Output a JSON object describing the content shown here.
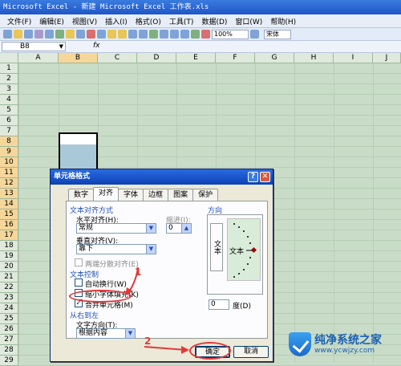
{
  "window": {
    "title": "Microsoft Excel - 新建 Microsoft Excel 工作表.xls"
  },
  "menu": [
    "文件(F)",
    "编辑(E)",
    "视图(V)",
    "插入(I)",
    "格式(O)",
    "工具(T)",
    "数据(D)",
    "窗口(W)",
    "帮助(H)"
  ],
  "toolbar": {
    "zoom": "100%",
    "font": "宋体"
  },
  "formula_bar": {
    "name_box": "B8",
    "fx": "fx"
  },
  "sheet": {
    "columns": [
      "A",
      "B",
      "C",
      "D",
      "E",
      "F",
      "G",
      "H",
      "I",
      "J"
    ],
    "selected_column": "B",
    "rows": [
      "1",
      "2",
      "3",
      "4",
      "5",
      "6",
      "7",
      "8",
      "9",
      "10",
      "11",
      "12",
      "13",
      "14",
      "15",
      "16",
      "17",
      "18",
      "19",
      "20",
      "21",
      "22",
      "23",
      "24",
      "25",
      "26",
      "27",
      "28",
      "29"
    ],
    "selected_rows_from": 8,
    "selected_rows_to": 17
  },
  "dialog": {
    "title": "单元格格式",
    "help": "?",
    "close": "✕",
    "tabs": [
      "数字",
      "对齐",
      "字体",
      "边框",
      "图案",
      "保护"
    ],
    "active_tab": "对齐",
    "text_align_group": "文本对齐方式",
    "h_align_label": "水平对齐(H):",
    "h_align_value": "常规",
    "indent_label": "缩进(I):",
    "indent_value": "0",
    "v_align_label": "垂直对齐(V):",
    "v_align_value": "靠下",
    "justify_distributed": "两端分散对齐(E)",
    "text_control_group": "文本控制",
    "wrap_text": "自动换行(W)",
    "shrink_to_fit": "缩小字体填充(K)",
    "merge_cells": "合并单元格(M)",
    "merge_checked": true,
    "rtl_group": "从右到左",
    "text_direction_label": "文字方向(T):",
    "text_direction_value": "根据内容",
    "orientation_group": "方向",
    "orientation_vertical_text": "文本",
    "orientation_text": "文本",
    "degree_value": "0",
    "degree_label": "度(D)",
    "ok": "确定",
    "cancel": "取消"
  },
  "annotations": {
    "step1": "1",
    "step2": "2"
  },
  "watermark": {
    "line1": "纯净系统之家",
    "line2": "www.ycwjzy.com"
  }
}
